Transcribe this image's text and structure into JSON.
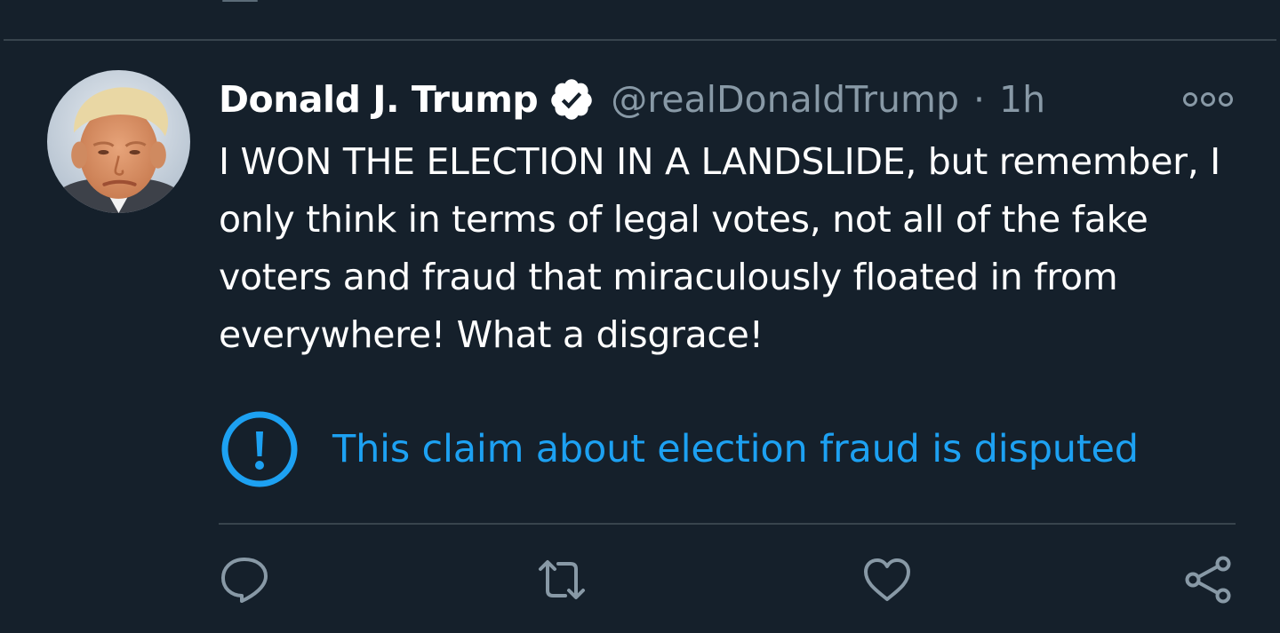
{
  "tweet": {
    "display_name": "Donald J. Trump",
    "handle": "@realDonaldTrump",
    "separator": "·",
    "time": "1h",
    "text": "I WON THE ELECTION IN A LANDSLIDE, but remember, I only think in terms of legal votes, not all of the fake voters and fraud that miraculously floated in from everywhere! What a disgrace!",
    "verified_icon": "verified-badge-icon",
    "avatar": "profile-photo"
  },
  "notice": {
    "icon": "exclamation-circle-icon",
    "text": "This claim about election fraud is disputed"
  },
  "actions": {
    "reply_icon": "reply-icon",
    "retweet_icon": "retweet-icon",
    "like_icon": "heart-icon",
    "share_icon": "share-icon"
  },
  "colors": {
    "background": "#15202b",
    "divider": "#38444d",
    "text_primary": "#ffffff",
    "text_secondary": "#8899a6",
    "accent": "#1da1f2"
  }
}
